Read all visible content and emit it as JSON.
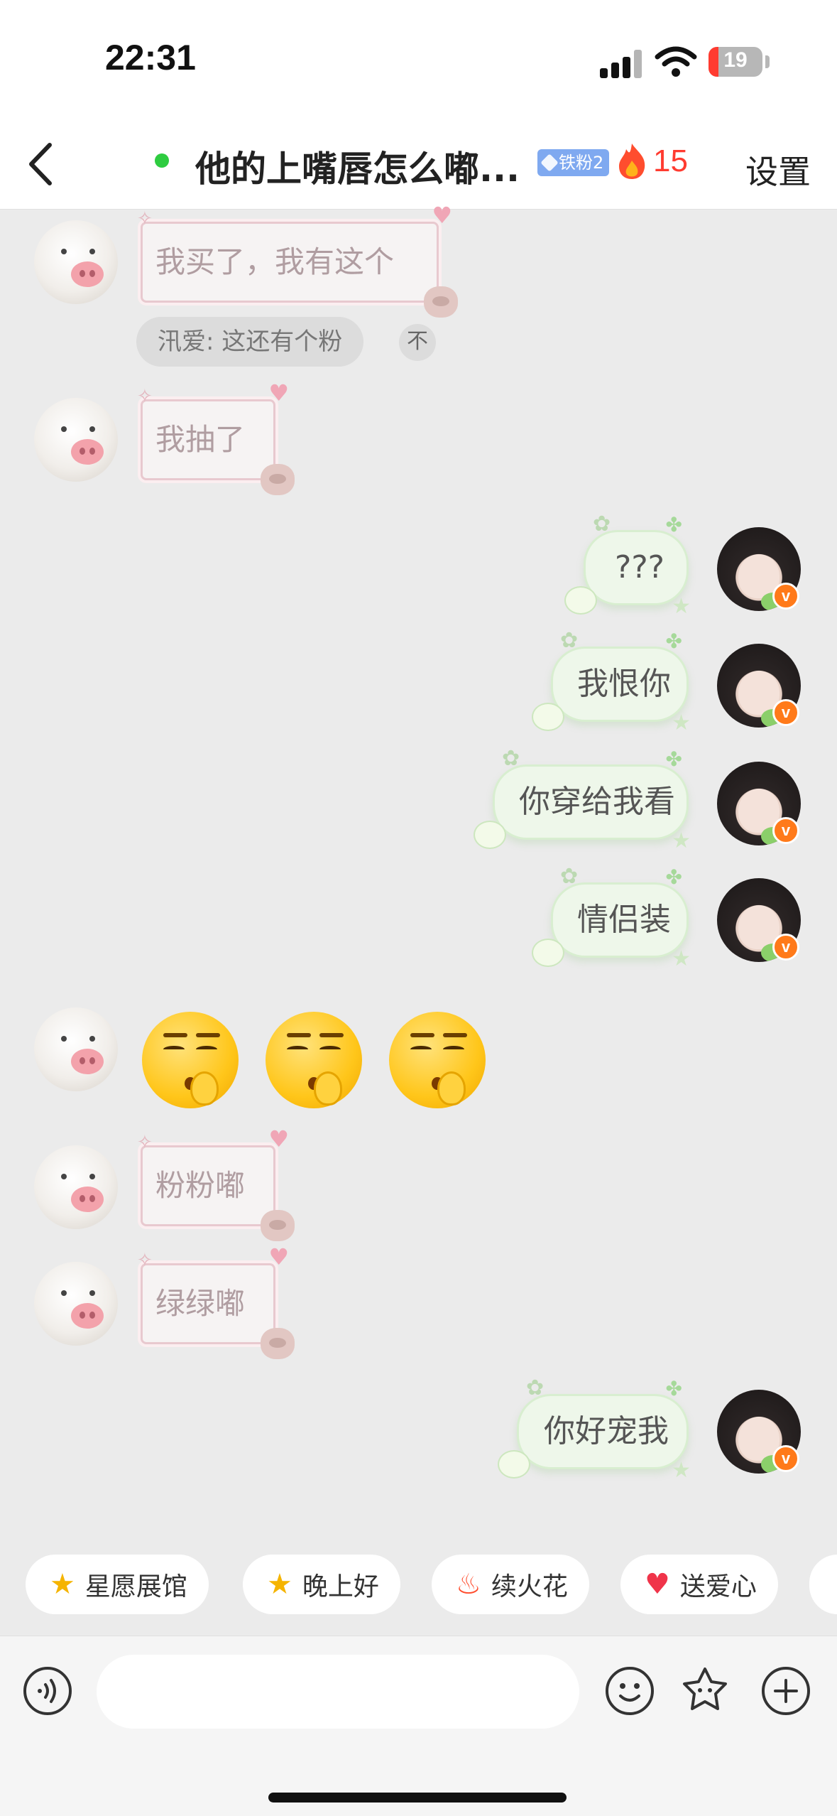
{
  "status_bar": {
    "time": "22:31",
    "battery": "19",
    "battery_level": 0.19
  },
  "header": {
    "title": "他的上嘴唇怎么嘟...",
    "fan_badge": "铁粉2",
    "streak_count": "15",
    "settings_label": "设置"
  },
  "messages": [
    {
      "side": "left",
      "type": "text",
      "text": "我买了，我有这个"
    },
    {
      "side": "left",
      "type": "quote",
      "text": "汛爱: 这还有个粉",
      "quote_action": "不"
    },
    {
      "side": "left",
      "type": "text",
      "text": "我抽了"
    },
    {
      "side": "right",
      "type": "text",
      "text": "???"
    },
    {
      "side": "right",
      "type": "text",
      "text": "我恨你"
    },
    {
      "side": "right",
      "type": "text",
      "text": "你穿给我看"
    },
    {
      "side": "right",
      "type": "text",
      "text": "情侣装"
    },
    {
      "side": "left",
      "type": "emoji",
      "emoji_name": "shushing-smirk-face-icon",
      "count": 3
    },
    {
      "side": "left",
      "type": "text",
      "text": "粉粉嘟"
    },
    {
      "side": "left",
      "type": "text",
      "text": "绿绿嘟"
    },
    {
      "side": "right",
      "type": "text",
      "text": "你好宠我"
    }
  ],
  "verified_badge": "v",
  "quick_chips": [
    {
      "label": "星愿展馆",
      "icon": "star-face-icon"
    },
    {
      "label": "晚上好",
      "icon": "star-face-icon"
    },
    {
      "label": "续火花",
      "icon": "flame-icon"
    },
    {
      "label": "送爱心",
      "icon": "heart-icon"
    }
  ],
  "input": {
    "placeholder": ""
  },
  "colors": {
    "background": "#ebebeb",
    "streak": "#ff3b30",
    "online": "#2ecc40",
    "badge": "#7fa9f0",
    "verified": "#ff7a1a",
    "pink_bubble_border": "#e8c9cf",
    "green_bubble_bg": "#eef7ea"
  }
}
